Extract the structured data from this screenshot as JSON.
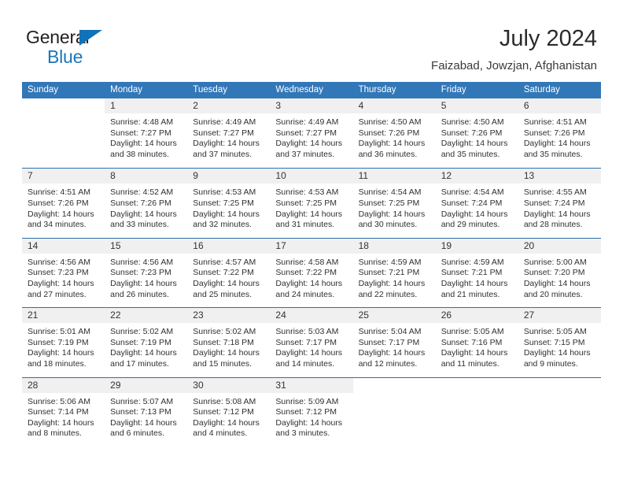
{
  "brand": {
    "name_part1": "General",
    "name_part2": "Blue",
    "triangle_color": "#1272b8",
    "blue_color": "#1b76bc"
  },
  "header": {
    "title": "July 2024",
    "subtitle": "Faizabad, Jowzjan, Afghanistan",
    "accent_color": "#3277b8"
  },
  "weekday_headers": [
    "Sunday",
    "Monday",
    "Tuesday",
    "Wednesday",
    "Thursday",
    "Friday",
    "Saturday"
  ],
  "weeks": [
    [
      {
        "day": "",
        "sunrise": "",
        "sunset": "",
        "daylight_line1": "",
        "daylight_line2": ""
      },
      {
        "day": "1",
        "sunrise": "Sunrise: 4:48 AM",
        "sunset": "Sunset: 7:27 PM",
        "daylight_line1": "Daylight: 14 hours",
        "daylight_line2": "and 38 minutes."
      },
      {
        "day": "2",
        "sunrise": "Sunrise: 4:49 AM",
        "sunset": "Sunset: 7:27 PM",
        "daylight_line1": "Daylight: 14 hours",
        "daylight_line2": "and 37 minutes."
      },
      {
        "day": "3",
        "sunrise": "Sunrise: 4:49 AM",
        "sunset": "Sunset: 7:27 PM",
        "daylight_line1": "Daylight: 14 hours",
        "daylight_line2": "and 37 minutes."
      },
      {
        "day": "4",
        "sunrise": "Sunrise: 4:50 AM",
        "sunset": "Sunset: 7:26 PM",
        "daylight_line1": "Daylight: 14 hours",
        "daylight_line2": "and 36 minutes."
      },
      {
        "day": "5",
        "sunrise": "Sunrise: 4:50 AM",
        "sunset": "Sunset: 7:26 PM",
        "daylight_line1": "Daylight: 14 hours",
        "daylight_line2": "and 35 minutes."
      },
      {
        "day": "6",
        "sunrise": "Sunrise: 4:51 AM",
        "sunset": "Sunset: 7:26 PM",
        "daylight_line1": "Daylight: 14 hours",
        "daylight_line2": "and 35 minutes."
      }
    ],
    [
      {
        "day": "7",
        "sunrise": "Sunrise: 4:51 AM",
        "sunset": "Sunset: 7:26 PM",
        "daylight_line1": "Daylight: 14 hours",
        "daylight_line2": "and 34 minutes."
      },
      {
        "day": "8",
        "sunrise": "Sunrise: 4:52 AM",
        "sunset": "Sunset: 7:26 PM",
        "daylight_line1": "Daylight: 14 hours",
        "daylight_line2": "and 33 minutes."
      },
      {
        "day": "9",
        "sunrise": "Sunrise: 4:53 AM",
        "sunset": "Sunset: 7:25 PM",
        "daylight_line1": "Daylight: 14 hours",
        "daylight_line2": "and 32 minutes."
      },
      {
        "day": "10",
        "sunrise": "Sunrise: 4:53 AM",
        "sunset": "Sunset: 7:25 PM",
        "daylight_line1": "Daylight: 14 hours",
        "daylight_line2": "and 31 minutes."
      },
      {
        "day": "11",
        "sunrise": "Sunrise: 4:54 AM",
        "sunset": "Sunset: 7:25 PM",
        "daylight_line1": "Daylight: 14 hours",
        "daylight_line2": "and 30 minutes."
      },
      {
        "day": "12",
        "sunrise": "Sunrise: 4:54 AM",
        "sunset": "Sunset: 7:24 PM",
        "daylight_line1": "Daylight: 14 hours",
        "daylight_line2": "and 29 minutes."
      },
      {
        "day": "13",
        "sunrise": "Sunrise: 4:55 AM",
        "sunset": "Sunset: 7:24 PM",
        "daylight_line1": "Daylight: 14 hours",
        "daylight_line2": "and 28 minutes."
      }
    ],
    [
      {
        "day": "14",
        "sunrise": "Sunrise: 4:56 AM",
        "sunset": "Sunset: 7:23 PM",
        "daylight_line1": "Daylight: 14 hours",
        "daylight_line2": "and 27 minutes."
      },
      {
        "day": "15",
        "sunrise": "Sunrise: 4:56 AM",
        "sunset": "Sunset: 7:23 PM",
        "daylight_line1": "Daylight: 14 hours",
        "daylight_line2": "and 26 minutes."
      },
      {
        "day": "16",
        "sunrise": "Sunrise: 4:57 AM",
        "sunset": "Sunset: 7:22 PM",
        "daylight_line1": "Daylight: 14 hours",
        "daylight_line2": "and 25 minutes."
      },
      {
        "day": "17",
        "sunrise": "Sunrise: 4:58 AM",
        "sunset": "Sunset: 7:22 PM",
        "daylight_line1": "Daylight: 14 hours",
        "daylight_line2": "and 24 minutes."
      },
      {
        "day": "18",
        "sunrise": "Sunrise: 4:59 AM",
        "sunset": "Sunset: 7:21 PM",
        "daylight_line1": "Daylight: 14 hours",
        "daylight_line2": "and 22 minutes."
      },
      {
        "day": "19",
        "sunrise": "Sunrise: 4:59 AM",
        "sunset": "Sunset: 7:21 PM",
        "daylight_line1": "Daylight: 14 hours",
        "daylight_line2": "and 21 minutes."
      },
      {
        "day": "20",
        "sunrise": "Sunrise: 5:00 AM",
        "sunset": "Sunset: 7:20 PM",
        "daylight_line1": "Daylight: 14 hours",
        "daylight_line2": "and 20 minutes."
      }
    ],
    [
      {
        "day": "21",
        "sunrise": "Sunrise: 5:01 AM",
        "sunset": "Sunset: 7:19 PM",
        "daylight_line1": "Daylight: 14 hours",
        "daylight_line2": "and 18 minutes."
      },
      {
        "day": "22",
        "sunrise": "Sunrise: 5:02 AM",
        "sunset": "Sunset: 7:19 PM",
        "daylight_line1": "Daylight: 14 hours",
        "daylight_line2": "and 17 minutes."
      },
      {
        "day": "23",
        "sunrise": "Sunrise: 5:02 AM",
        "sunset": "Sunset: 7:18 PM",
        "daylight_line1": "Daylight: 14 hours",
        "daylight_line2": "and 15 minutes."
      },
      {
        "day": "24",
        "sunrise": "Sunrise: 5:03 AM",
        "sunset": "Sunset: 7:17 PM",
        "daylight_line1": "Daylight: 14 hours",
        "daylight_line2": "and 14 minutes."
      },
      {
        "day": "25",
        "sunrise": "Sunrise: 5:04 AM",
        "sunset": "Sunset: 7:17 PM",
        "daylight_line1": "Daylight: 14 hours",
        "daylight_line2": "and 12 minutes."
      },
      {
        "day": "26",
        "sunrise": "Sunrise: 5:05 AM",
        "sunset": "Sunset: 7:16 PM",
        "daylight_line1": "Daylight: 14 hours",
        "daylight_line2": "and 11 minutes."
      },
      {
        "day": "27",
        "sunrise": "Sunrise: 5:05 AM",
        "sunset": "Sunset: 7:15 PM",
        "daylight_line1": "Daylight: 14 hours",
        "daylight_line2": "and 9 minutes."
      }
    ],
    [
      {
        "day": "28",
        "sunrise": "Sunrise: 5:06 AM",
        "sunset": "Sunset: 7:14 PM",
        "daylight_line1": "Daylight: 14 hours",
        "daylight_line2": "and 8 minutes."
      },
      {
        "day": "29",
        "sunrise": "Sunrise: 5:07 AM",
        "sunset": "Sunset: 7:13 PM",
        "daylight_line1": "Daylight: 14 hours",
        "daylight_line2": "and 6 minutes."
      },
      {
        "day": "30",
        "sunrise": "Sunrise: 5:08 AM",
        "sunset": "Sunset: 7:12 PM",
        "daylight_line1": "Daylight: 14 hours",
        "daylight_line2": "and 4 minutes."
      },
      {
        "day": "31",
        "sunrise": "Sunrise: 5:09 AM",
        "sunset": "Sunset: 7:12 PM",
        "daylight_line1": "Daylight: 14 hours",
        "daylight_line2": "and 3 minutes."
      },
      {
        "day": "",
        "sunrise": "",
        "sunset": "",
        "daylight_line1": "",
        "daylight_line2": ""
      },
      {
        "day": "",
        "sunrise": "",
        "sunset": "",
        "daylight_line1": "",
        "daylight_line2": ""
      },
      {
        "day": "",
        "sunrise": "",
        "sunset": "",
        "daylight_line1": "",
        "daylight_line2": ""
      }
    ]
  ]
}
